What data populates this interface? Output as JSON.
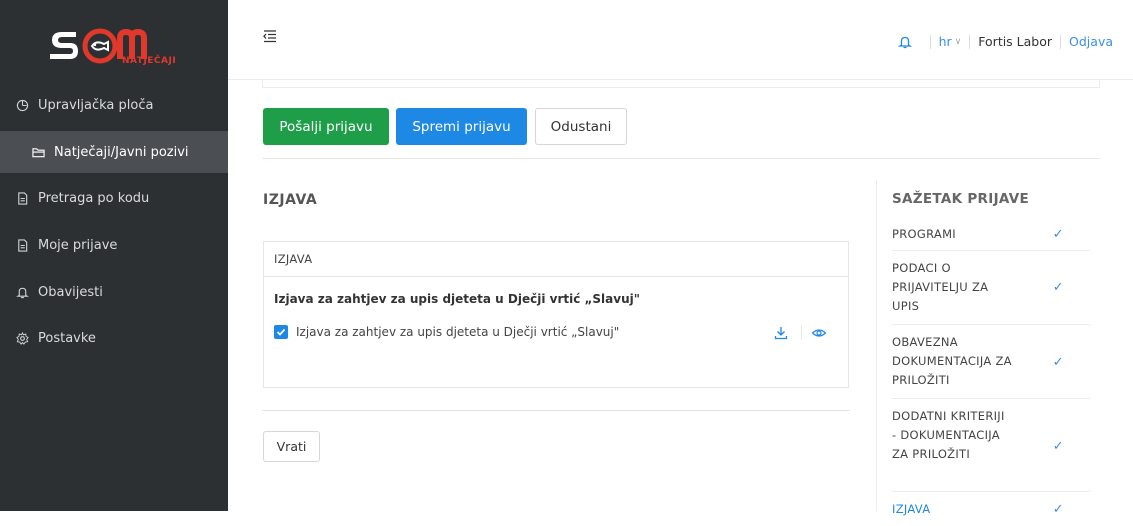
{
  "app": {
    "brand_logo_text": "SOM",
    "brand_sub": "NATJEČAJI"
  },
  "sidebar": {
    "items": [
      {
        "label": "Upravljačka ploča",
        "icon": "dashboard-icon"
      },
      {
        "label": "Natječaji/Javni pozivi",
        "icon": "folder-icon",
        "active": true
      },
      {
        "label": "Pretraga po kodu",
        "icon": "document-icon"
      },
      {
        "label": "Moje prijave",
        "icon": "document-icon"
      },
      {
        "label": "Obavijesti",
        "icon": "bell-icon"
      },
      {
        "label": "Postavke",
        "icon": "gear-icon"
      }
    ]
  },
  "topbar": {
    "language": "hr",
    "user": "Fortis Labor",
    "logout": "Odjava"
  },
  "actions": {
    "send": "Pošalji prijavu",
    "save": "Spremi prijavu",
    "cancel": "Odustani",
    "back": "Vrati"
  },
  "main": {
    "section_title": "IZJAVA",
    "card": {
      "header": "IZJAVA",
      "question": "Izjava za zahtjev za upis djeteta u Dječji vrtić „Slavuj\"",
      "checkbox_label": "Izjava za zahtjev za upis djeteta u Dječji vrtić „Slavuj\"",
      "checked": true
    }
  },
  "summary": {
    "title": "SAŽETAK PRIJAVE",
    "items": [
      {
        "label": "PROGRAMI",
        "done": true
      },
      {
        "label": "PODACI O PRIJAVITELJU ZA UPIS",
        "done": true
      },
      {
        "label": "OBAVEZNA DOKUMENTACIJA ZA PRILOŽITI",
        "done": true
      },
      {
        "label": "DODATNI KRITERIJI - DOKUMENTACIJA ZA PRILOŽITI",
        "done": true
      },
      {
        "label": "IZJAVA",
        "done": true
      }
    ],
    "tick": "✓"
  },
  "colors": {
    "primary": "#1e88e5",
    "success": "#1f9e4a",
    "sidebar": "#2d3033",
    "brand": "#e0392b"
  }
}
